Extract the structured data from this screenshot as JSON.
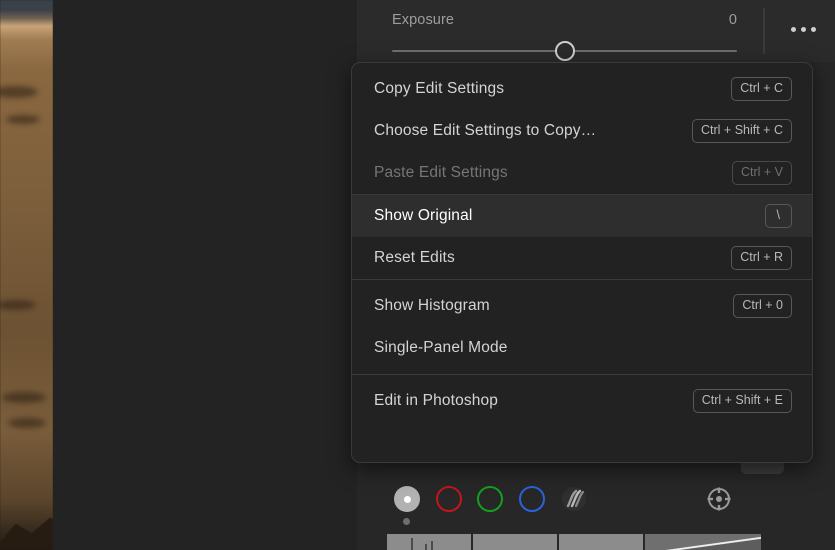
{
  "app": {
    "theme_background": "#232323",
    "panel_background": "#272727",
    "menu_background": "#222222",
    "highlight_background": "#2e2e2e"
  },
  "photo": {
    "alt_description": "desert landscape photo edge"
  },
  "panel_header": {
    "slider": {
      "name": "Exposure",
      "value": "0",
      "position_percent": 50
    },
    "overflow_button": "more-options"
  },
  "context_menu": {
    "groups": [
      {
        "items": [
          {
            "label": "Copy Edit Settings",
            "shortcut": "Ctrl + C",
            "state": "normal"
          },
          {
            "label": "Choose Edit Settings to Copy…",
            "shortcut": "Ctrl + Shift + C",
            "state": "normal"
          },
          {
            "label": "Paste Edit Settings",
            "shortcut": "Ctrl + V",
            "state": "disabled"
          }
        ]
      },
      {
        "items": [
          {
            "label": "Show Original",
            "shortcut": "\\",
            "state": "highlight"
          },
          {
            "label": "Reset Edits",
            "shortcut": "Ctrl + R",
            "state": "normal"
          }
        ]
      },
      {
        "items": [
          {
            "label": "Show Histogram",
            "shortcut": "Ctrl + 0",
            "state": "normal"
          },
          {
            "label": "Single-Panel Mode",
            "shortcut": "",
            "state": "normal"
          }
        ]
      },
      {
        "items": [
          {
            "label": "Edit in Photoshop",
            "shortcut": "Ctrl + Shift + E",
            "state": "normal"
          }
        ]
      }
    ]
  },
  "curve_toolbar": {
    "channels": [
      {
        "name": "rgb-composite",
        "color": "#b2b2b2",
        "selected": true
      },
      {
        "name": "red-channel",
        "color": "#c4161c",
        "selected": false
      },
      {
        "name": "green-channel",
        "color": "#14a01e",
        "selected": false
      },
      {
        "name": "blue-channel",
        "color": "#2a62dd",
        "selected": false
      },
      {
        "name": "parametric-curve",
        "color": "#7a7a7a",
        "selected": false
      }
    ],
    "target_adjustment_tool": "targeted-adjustment"
  }
}
